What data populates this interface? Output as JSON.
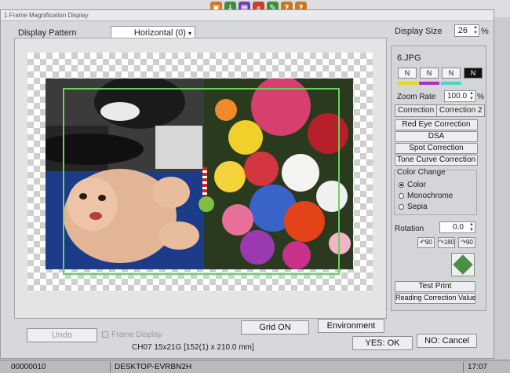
{
  "window": {
    "title": "1 Frame Magnification Display"
  },
  "toolbar_icons": [
    {
      "name": "photo-icon",
      "color": "#d8741e"
    },
    {
      "name": "download-icon",
      "color": "#3f8f3a"
    },
    {
      "name": "grid-icon",
      "color": "#6f3fb0"
    },
    {
      "name": "magnifier-icon",
      "color": "#c8402e"
    },
    {
      "name": "pencil-icon",
      "color": "#3f8f3a"
    },
    {
      "name": "help-icon",
      "color": "#c47a1e"
    },
    {
      "name": "help-icon-2",
      "color": "#c47a1e"
    }
  ],
  "header": {
    "display_pattern_label": "Display Pattern",
    "display_pattern_value": "Horizontal (0)",
    "display_size_label": "Display Size",
    "display_size_value": "26",
    "display_size_unit": "%"
  },
  "panel": {
    "filename": "6.JPG",
    "n_buttons": [
      "N",
      "N",
      "N",
      "N"
    ],
    "n_colors": [
      "#e6d81a",
      "#b02fc0",
      "#45d6c8"
    ],
    "zoom_label": "Zoom Rate",
    "zoom_value": "100.0",
    "zoom_unit": "%",
    "tabs": [
      "Correction 1",
      "Correction 2"
    ],
    "buttons": [
      "Red Eye Correction",
      "DSA",
      "Spot Correction",
      "Tone Curve Correction"
    ],
    "color_change_label": "Color Change",
    "color_options": [
      "Color",
      "Monochrome",
      "Sepia"
    ],
    "color_selected": "Color",
    "rotation_label": "Rotation",
    "rotation_value": "0.0",
    "rotate_buttons": [
      "↶90",
      "↷180",
      "↷90"
    ],
    "test_print": "Test Print",
    "reading_correction": "Reading Correction Value"
  },
  "bottom": {
    "undo": "Undo",
    "frame_display": "Frame Display",
    "grid_on": "Grid ON",
    "environment": "Environment",
    "info": "CH07  15x21G  [152(1) x 210.0 mm]",
    "yes_ok": "YES: OK",
    "no_cancel": "NO: Cancel"
  },
  "status": {
    "code": "00000010",
    "computer": "DESKTOP-EVRBN2H",
    "time": "17:07"
  }
}
